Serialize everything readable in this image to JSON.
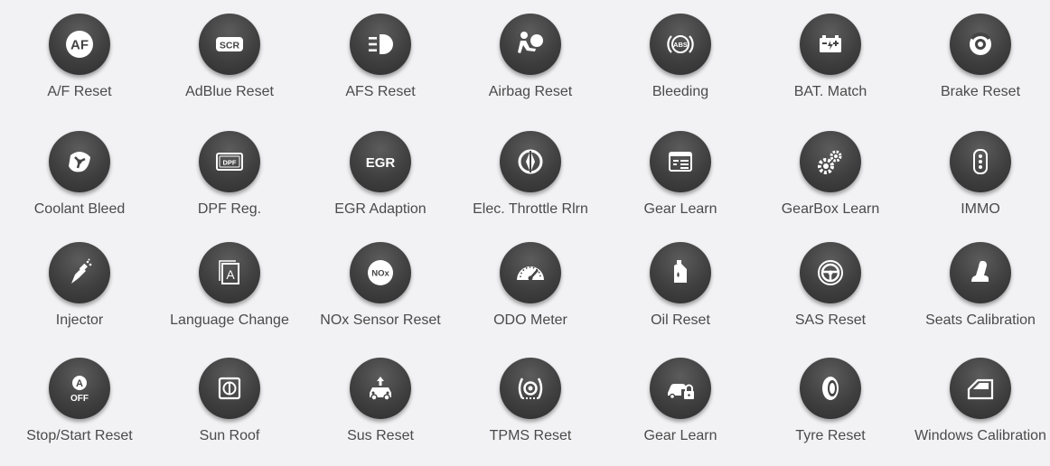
{
  "functions": [
    {
      "label": "A/F Reset",
      "icon": "af-icon"
    },
    {
      "label": "AdBlue Reset",
      "icon": "scr-icon"
    },
    {
      "label": "AFS Reset",
      "icon": "headlight-icon"
    },
    {
      "label": "Airbag Reset",
      "icon": "airbag-icon"
    },
    {
      "label": "Bleeding",
      "icon": "abs-icon"
    },
    {
      "label": "BAT. Match",
      "icon": "battery-icon"
    },
    {
      "label": "Brake Reset",
      "icon": "brake-disc-icon"
    },
    {
      "label": "Coolant Bleed",
      "icon": "fan-icon"
    },
    {
      "label": "DPF Reg.",
      "icon": "dpf-icon"
    },
    {
      "label": "EGR Adaption",
      "icon": "egr-icon"
    },
    {
      "label": "Elec. Throttle Rlrn",
      "icon": "throttle-icon"
    },
    {
      "label": "Gear Learn",
      "icon": "window-icon"
    },
    {
      "label": "GearBox Learn",
      "icon": "gears-icon"
    },
    {
      "label": "IMMO",
      "icon": "key-fob-icon"
    },
    {
      "label": "Injector",
      "icon": "injector-icon"
    },
    {
      "label": "Language Change",
      "icon": "language-icon"
    },
    {
      "label": "NOx Sensor Reset",
      "icon": "nox-icon"
    },
    {
      "label": "ODO Meter",
      "icon": "speedometer-icon"
    },
    {
      "label": "Oil Reset",
      "icon": "oil-can-icon"
    },
    {
      "label": "SAS Reset",
      "icon": "steering-wheel-icon"
    },
    {
      "label": "Seats Calibration",
      "icon": "seat-icon"
    },
    {
      "label": "Stop/Start Reset",
      "icon": "auto-off-icon"
    },
    {
      "label": "Sun Roof",
      "icon": "sunroof-icon"
    },
    {
      "label": "Sus Reset",
      "icon": "suspension-icon"
    },
    {
      "label": "TPMS Reset",
      "icon": "tpms-icon"
    },
    {
      "label": "Gear Learn",
      "icon": "car-lock-icon"
    },
    {
      "label": "Tyre Reset",
      "icon": "tyre-icon"
    },
    {
      "label": "Windows Calibration",
      "icon": "car-window-icon"
    }
  ],
  "icon_text": {
    "af": "AF",
    "scr": "SCR",
    "abs": "ABS",
    "dpf": "DPF",
    "egr": "EGR",
    "nox": "NOx",
    "language": "A",
    "auto": "A",
    "off": "OFF"
  }
}
